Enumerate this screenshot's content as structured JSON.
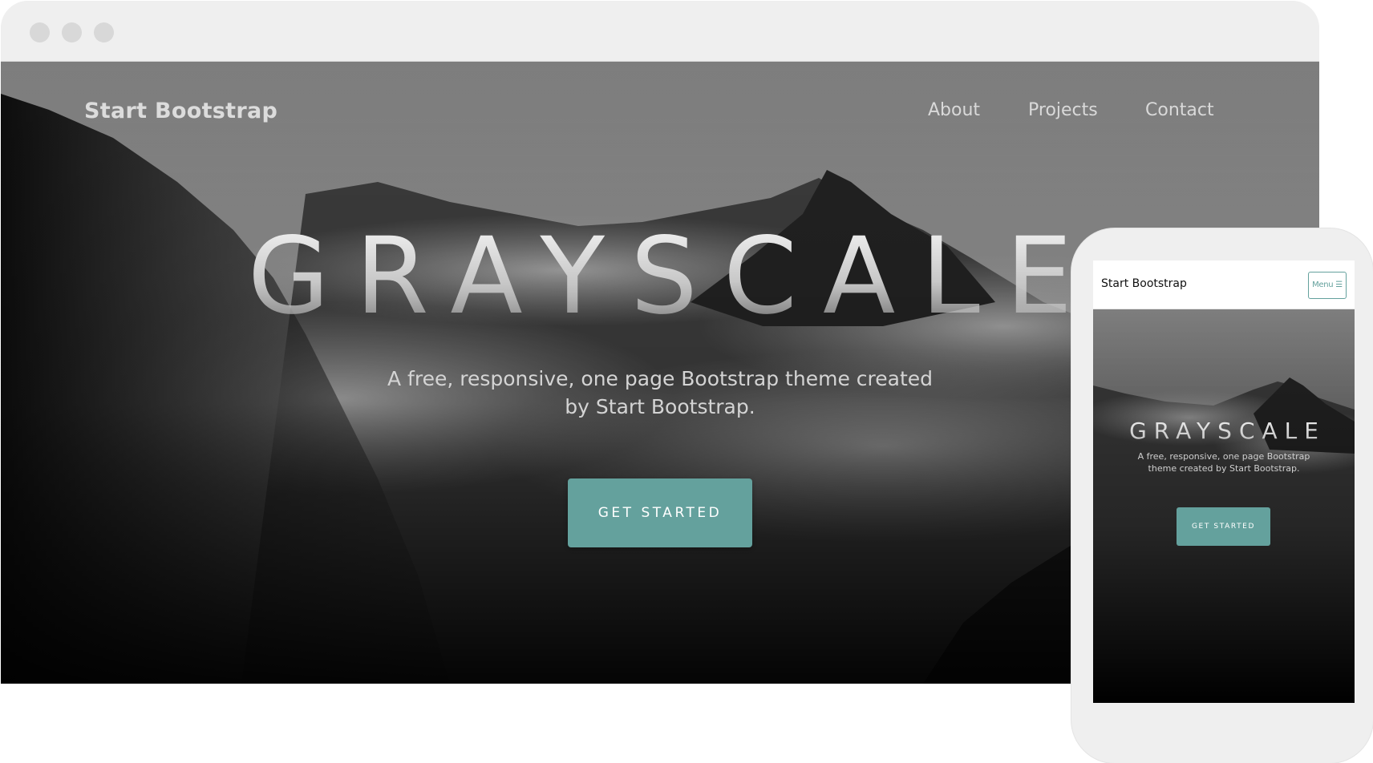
{
  "desktop": {
    "brand": "Start Bootstrap",
    "nav_links": [
      "About",
      "Projects",
      "Contact"
    ],
    "hero": {
      "title": "GRAYSCALE",
      "subtitle": "A free, responsive, one page Bootstrap theme created by Start Bootstrap.",
      "cta_label": "GET STARTED"
    }
  },
  "mobile": {
    "brand": "Start Bootstrap",
    "menu_label": "Menu ☰",
    "hero": {
      "title": "GRAYSCALE",
      "subtitle": "A free, responsive, one page Bootstrap theme created by Start Bootstrap.",
      "cta_label": "GET STARTED"
    }
  },
  "colors": {
    "accent": "#64a19d",
    "frame": "#efefef",
    "window_dot": "#d8d8d8"
  },
  "icons": [
    "window-dot-icon",
    "hamburger-menu-icon"
  ]
}
